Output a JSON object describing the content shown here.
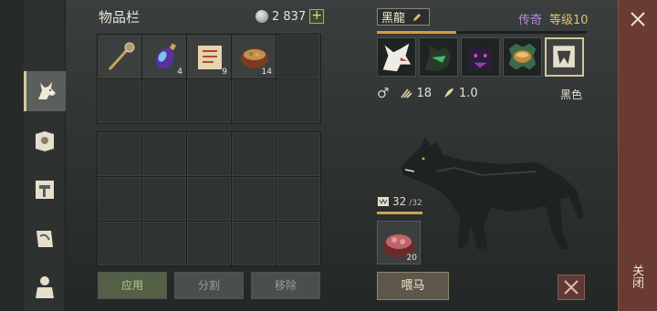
{
  "inventory": {
    "title": "物品栏",
    "coins": "2 837",
    "add_coins": "+",
    "items": [
      {
        "icon": "scepter-icon",
        "count": ""
      },
      {
        "icon": "potion-icon",
        "count": "4"
      },
      {
        "icon": "scroll-icon",
        "count": "9"
      },
      {
        "icon": "stew-icon",
        "count": "14"
      }
    ],
    "buttons": {
      "apply": "应用",
      "split": "分割",
      "move": "移除"
    }
  },
  "pet": {
    "name": "黑龍",
    "rarity": "传奇",
    "level": "等级10",
    "xp_fraction": 0.38,
    "traits": [
      "wolf-howl-icon",
      "wolf-green-icon",
      "wolf-purple-icon",
      "bowl-icon",
      "fang-tooth-icon"
    ],
    "gender": "♂",
    "attack": "18",
    "speed": "1.0",
    "color": "黑色",
    "food": {
      "current": "32",
      "max": "/32",
      "slot_count": "20"
    },
    "feed_button": "喂马"
  },
  "close": {
    "label": "关闭"
  },
  "colors": {
    "accent_gold": "#d8c89a",
    "rarity_purple": "#b98ae2",
    "level_gold": "#e0c070",
    "close_red": "#6a3b33"
  }
}
